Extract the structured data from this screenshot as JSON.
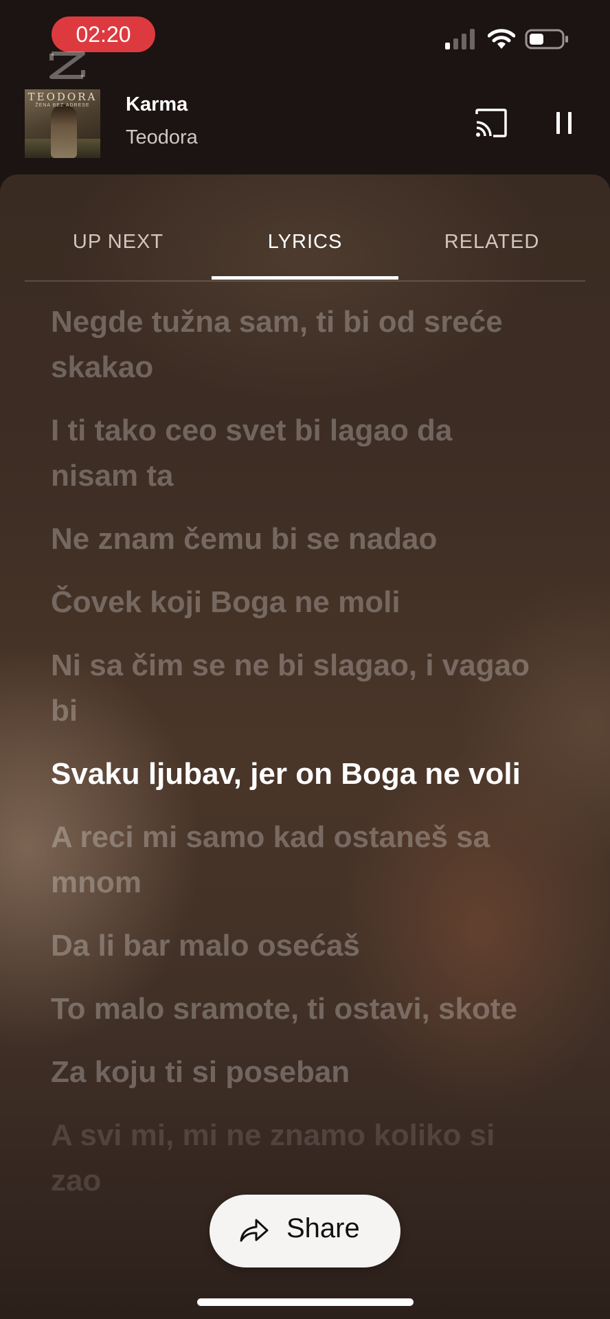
{
  "status_bar": {
    "time": "02:20",
    "time_badge_color": "#dd3a3f",
    "icons": [
      "signal-icon",
      "wifi-icon",
      "battery-icon"
    ]
  },
  "overlay_icon": "capcut-icon",
  "now_playing": {
    "title": "Karma",
    "artist": "Teodora",
    "album_art": {
      "title": "TEODORA",
      "subtitle": "ŽENA BEZ ADRESE"
    },
    "controls": [
      "cast-icon",
      "pause-icon"
    ]
  },
  "tabs": [
    {
      "label": "UP NEXT",
      "active": false
    },
    {
      "label": "LYRICS",
      "active": true
    },
    {
      "label": "RELATED",
      "active": false
    }
  ],
  "lyrics": [
    "Negde tužna sam, ti bi od sreće skakao",
    "I ti tako ceo svet bi lagao da nisam ta",
    "Ne znam čemu bi se nadao",
    "Čovek koji Boga ne moli",
    "Ni sa čim se ne bi slagao, i vagao bi",
    "Svaku ljubav, jer on Boga ne voli",
    "A reci mi samo kad ostaneš sa mnom",
    "Da li bar malo osećaš",
    "To malo sramote, ti ostavi, skote",
    "Za koju ti si poseban",
    "A svi mi, mi ne znamo koliko si zao"
  ],
  "active_lyric_index": 5,
  "share": {
    "label": "Share"
  }
}
